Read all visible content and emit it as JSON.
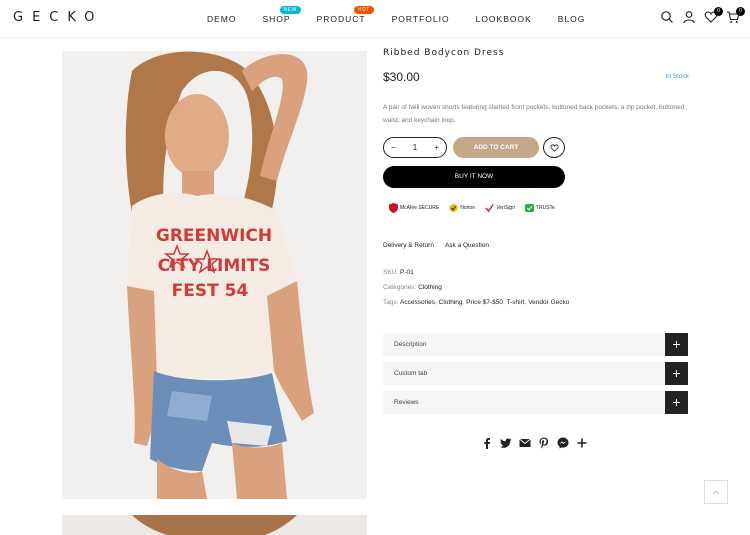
{
  "header": {
    "logo": "GECKO",
    "nav": [
      {
        "label": "DEMO"
      },
      {
        "label": "SHOP",
        "badge": "NEW"
      },
      {
        "label": "PRODUCT",
        "badge": "HOT"
      },
      {
        "label": "PORTFOLIO"
      },
      {
        "label": "LOOKBOOK"
      },
      {
        "label": "BLOG"
      }
    ],
    "wishlist_count": "0",
    "cart_count": "0",
    "icons": [
      "search-icon",
      "user-icon",
      "heart-icon",
      "cart-icon"
    ]
  },
  "product": {
    "title": "Ribbed Bodycon Dress",
    "price": "$30.00",
    "stock": "In Stock",
    "description": "A pair of twill woven shorts featuring slanted front pockets, buttoned back pockets, a zip pocket, buttoned waist, and keychain loop.",
    "quantity": "1",
    "qty_minus": "−",
    "qty_plus": "+",
    "add_to_cart": "ADD TO CART",
    "buy_now": "BUY IT NOW",
    "image_text": {
      "line1": "GREENWICH",
      "line2": "CITY LIMITS",
      "line3": "FEST 54"
    }
  },
  "trust_badges": {
    "mcafee": "McAfee SECURE",
    "norton": "Norton",
    "verisign": "VeriSign",
    "truste": "TRUSTe"
  },
  "links": {
    "delivery": "Delivery & Return",
    "ask": "Ask a Question"
  },
  "meta": {
    "sku_label": "SKU:",
    "sku_value": "P-01",
    "categories_label": "Categories:",
    "categories_value": "Clothing",
    "tags_label": "Tags:",
    "tags": [
      "Accessories",
      "Clothing",
      "Price $7-$50",
      "T-shirt",
      "Vendor Gecko"
    ]
  },
  "accordion": [
    {
      "label": "Description"
    },
    {
      "label": "Custom tab"
    },
    {
      "label": "Reviews"
    }
  ],
  "share_icons": [
    "facebook-icon",
    "twitter-icon",
    "email-icon",
    "pinterest-icon",
    "messenger-icon",
    "plus-icon"
  ],
  "colors": {
    "accent_tan": "#c4a889",
    "badge_new": "#01bad4",
    "badge_hot": "#ff4e00",
    "stock_blue": "#3a9ad9",
    "dark": "#222222"
  }
}
